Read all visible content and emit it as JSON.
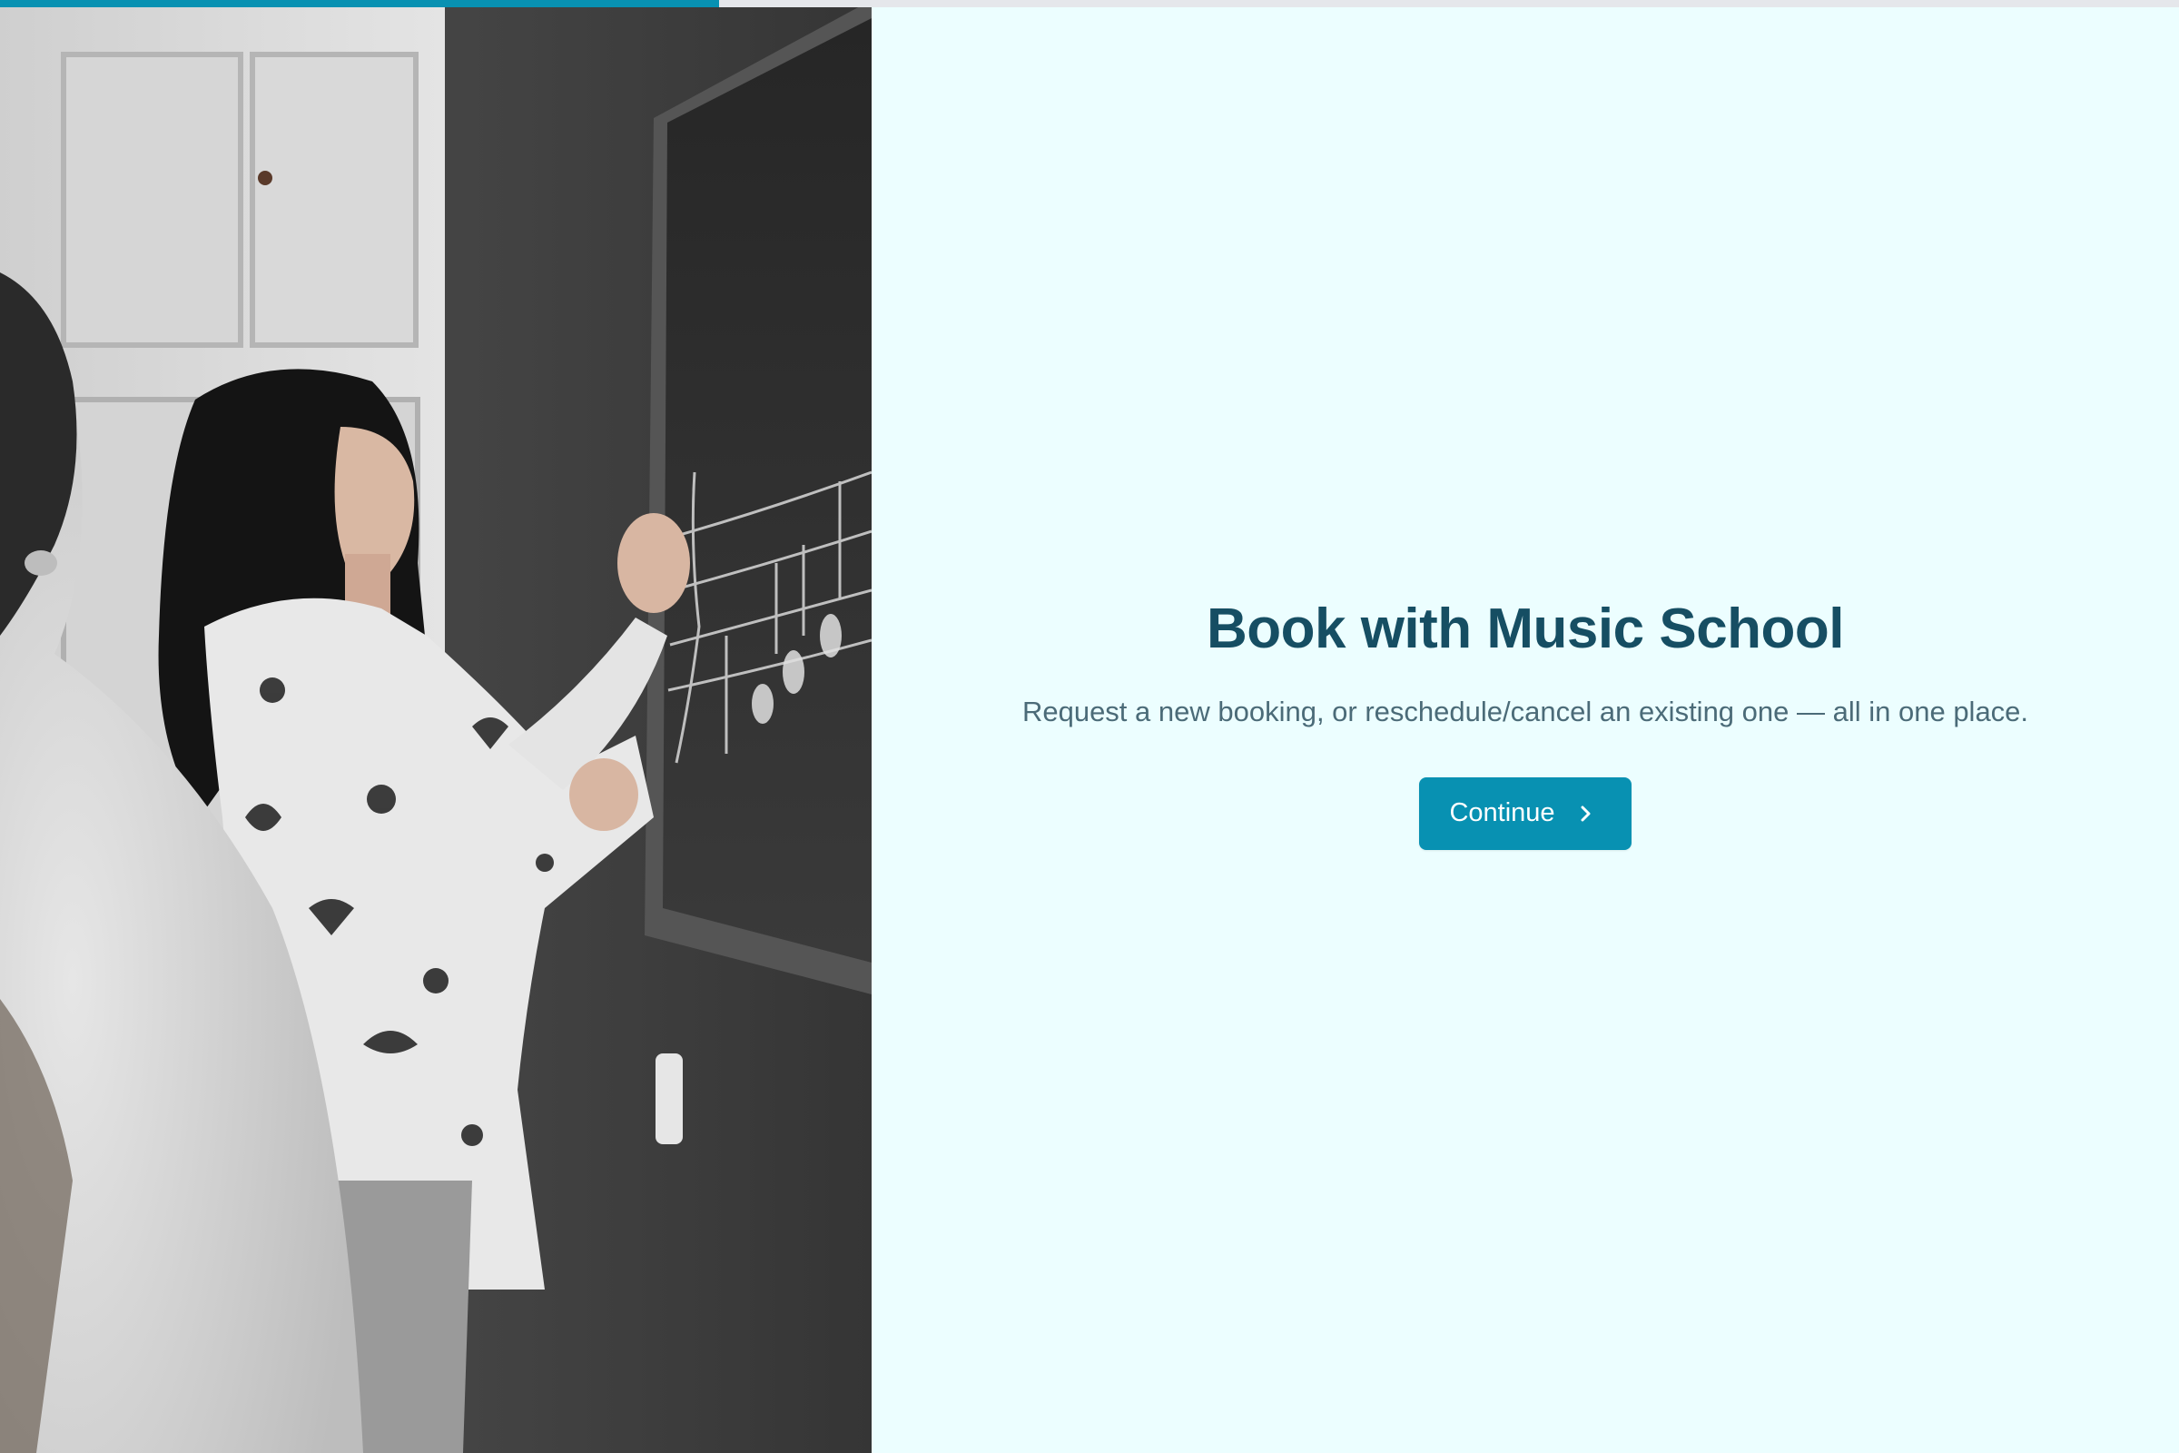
{
  "progress": {
    "value_fraction": 0.33,
    "accent_color": "#0891b2"
  },
  "photo": {
    "icon": "music-teacher-chalkboard-photo"
  },
  "hero": {
    "title": "Book with Music School",
    "subtitle": "Request a new booking, or reschedule/cancel an existing one — all in one place.",
    "continue_label": "Continue",
    "continue_icon": "chevron-right-icon"
  },
  "colors": {
    "background": "#ecfeff",
    "title": "#164e63",
    "subtitle": "#4b6b78",
    "button": "#0891b2"
  }
}
